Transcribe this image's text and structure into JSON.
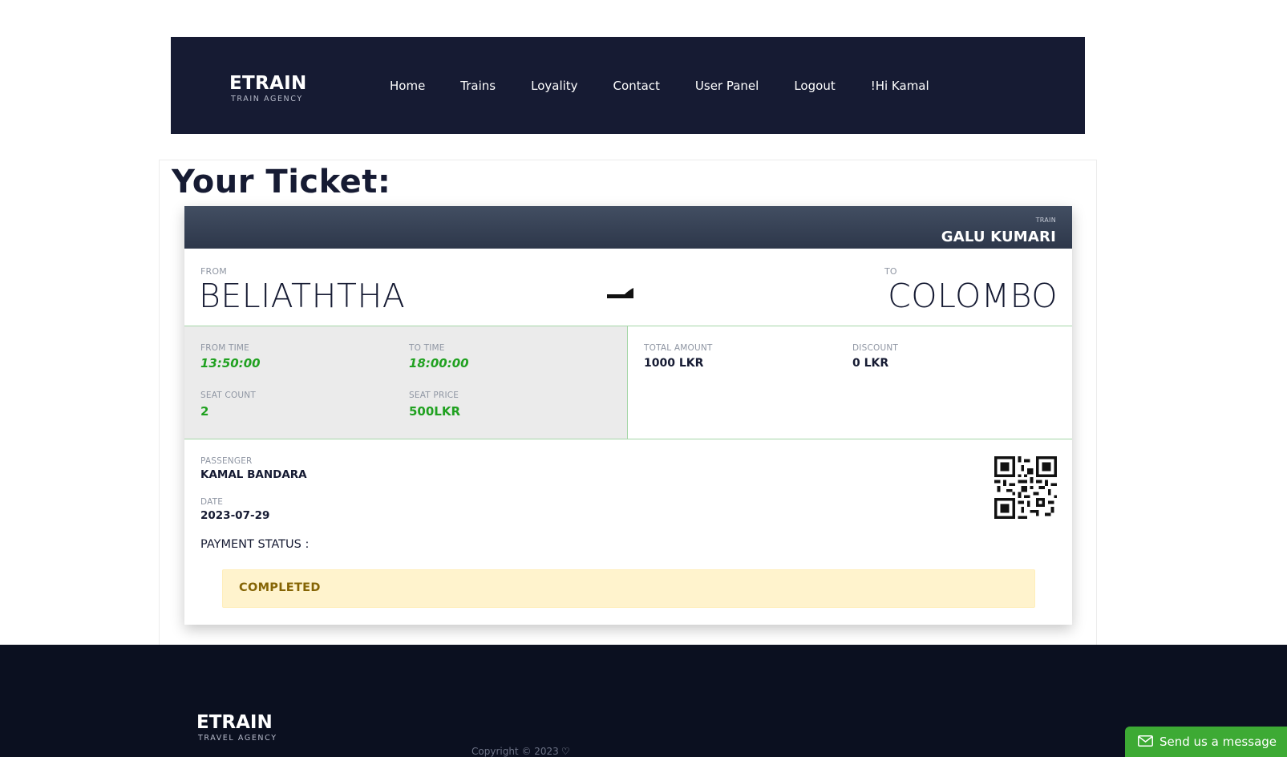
{
  "navbar": {
    "brand_name": "ETRAIN",
    "brand_tagline": "TRAIN AGENCY",
    "links": [
      "Home",
      "Trains",
      "Loyality",
      "Contact",
      "User Panel",
      "Logout",
      "!Hi Kamal"
    ]
  },
  "page": {
    "title": "Your Ticket:"
  },
  "ticket": {
    "train_label": "TRAIN",
    "train_name": "GALU KUMARI",
    "from_label": "FROM",
    "from_value": "BELIATHTHA",
    "to_label": "TO",
    "to_value": "COLOMBO",
    "from_time_label": "FROM TIME",
    "from_time": "13:50:00",
    "to_time_label": "TO TIME",
    "to_time": "18:00:00",
    "seat_count_label": "SEAT COUNT",
    "seat_count": "2",
    "seat_price_label": "SEAT PRICE",
    "seat_price": "500LKR",
    "total_amount_label": "TOTAL AMOUNT",
    "total_amount": "1000 LKR",
    "discount_label": "DISCOUNT",
    "discount": "0 LKR",
    "passenger_label": "PASSENGER",
    "passenger": "KAMAL BANDARA",
    "date_label": "DATE",
    "date": "2023-07-29",
    "payment_status_label": "PAYMENT STATUS :",
    "payment_status": "COMPLETED",
    "qr_icon": "qr-code-icon",
    "train_icon": "train-icon"
  },
  "footer": {
    "brand_name": "ETRAIN",
    "brand_tagline": "TRAVEL AGENCY",
    "copyright": "Copyright © 2023",
    "heart_icon": "heart-icon"
  },
  "chat_widget": {
    "label": "Send us a message",
    "icon": "mail-icon"
  },
  "colors": {
    "navbar_bg": "#161b33",
    "footer_bg": "#0b1020",
    "accent_green": "#20a120",
    "status_bg": "#fff3cd",
    "status_text": "#856404",
    "chat_green": "#3daa34"
  }
}
